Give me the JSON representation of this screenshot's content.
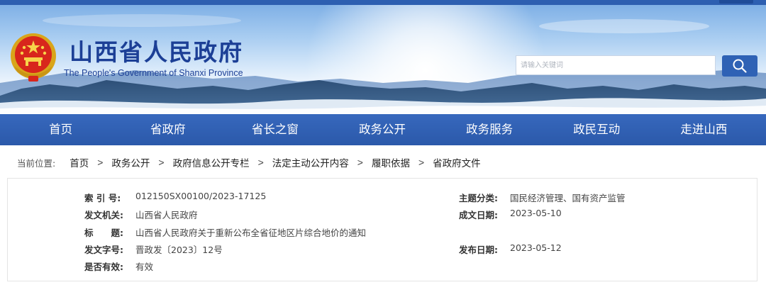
{
  "header": {
    "title": "山西省人民政府",
    "subtitle": "The People's Government of Shanxi Province",
    "emblem_icon": "national-emblem-icon",
    "search": {
      "placeholder": "请输入关键词",
      "value": ""
    },
    "search_icon": "search-icon"
  },
  "nav": {
    "items": [
      "首页",
      "省政府",
      "省长之窗",
      "政务公开",
      "政务服务",
      "政民互动",
      "走进山西"
    ]
  },
  "breadcrumb": {
    "prefix": "当前位置:",
    "items": [
      "首页",
      "政务公开",
      "政府信息公开专栏",
      "法定主动公开内容",
      "履职依据",
      "省政府文件"
    ],
    "separator": ">"
  },
  "document_info": {
    "index_label": "索 引 号:",
    "index_value": "012150SX00100/2023-17125",
    "topic_label": "主题分类:",
    "topic_value": "国民经济管理、国有资产监管",
    "issuer_label": "发文机关:",
    "issuer_value": "山西省人民政府",
    "date_written_label": "成文日期:",
    "date_written_value": "2023-05-10",
    "title_label": "标　　题:",
    "title_value": "山西省人民政府关于重新公布全省征地区片综合地价的通知",
    "doc_number_label": "发文字号:",
    "doc_number_value": "晋政发〔2023〕12号",
    "publish_date_label": "发布日期:",
    "publish_date_value": "2023-05-12",
    "valid_label": "是否有效:",
    "valid_value": "有效"
  },
  "colors": {
    "nav_blue": "#2d5fb1",
    "title_blue": "#1c3f96",
    "search_button": "#2f62b5"
  }
}
